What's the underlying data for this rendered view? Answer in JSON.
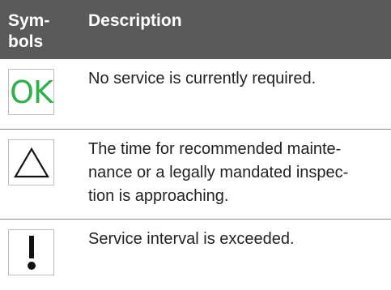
{
  "header": {
    "symbols_label": "Sym-\nbols",
    "description_label": "Description"
  },
  "rows": [
    {
      "symbol_text": "OK",
      "symbol_icon": "ok-icon",
      "symbol_color": "#2db24a",
      "description": "No service is currently required."
    },
    {
      "symbol_icon": "warning-triangle-icon",
      "description": "The time for recommended mainte-\nnance or a legally mandated inspec-\ntion is approaching."
    },
    {
      "symbol_icon": "exclamation-icon",
      "description": "Service interval is exceeded."
    }
  ],
  "colors": {
    "header_bg": "#5a5a5a",
    "header_text": "#ffffff",
    "divider": "#8a8a8a",
    "ok_green": "#2db24a"
  }
}
